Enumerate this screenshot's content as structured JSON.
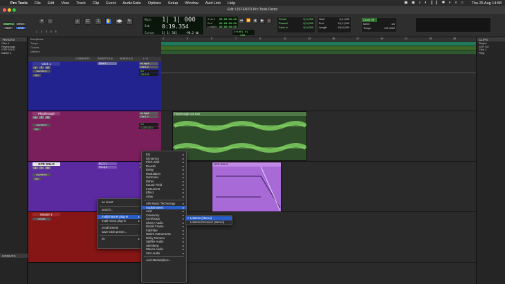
{
  "menubar": {
    "apple": "",
    "app": "Pro Tools",
    "items": [
      "File",
      "Edit",
      "View",
      "Track",
      "Clip",
      "Event",
      "AudioSuite",
      "Options",
      "Setup",
      "Window",
      "Avid Link",
      "Help"
    ],
    "clock": "Thu 25 Aug  14:58"
  },
  "window": {
    "title": "Edit: LISTENTO Pro Tools Demo"
  },
  "toolbar": {
    "modes": [
      "SHUFFLE",
      "SPOT",
      "SLIP",
      "GRID"
    ],
    "counters": {
      "main_label": "Main",
      "main_value": "1| 1| 000",
      "sub_label": "Sub",
      "sub_value": "0:19.354",
      "cursor_label": "Cursor",
      "cursor_value": "5| 1| 541",
      "start_label": "Start",
      "start_value": "00:00:00:00",
      "end_label": "End",
      "end_value": "00:00:00:00",
      "length_label": "Length",
      "length_value": "00:00:00:00",
      "grid_label": "Grid",
      "grid_value": "0| 0| 240",
      "nudge_label": "Nudge",
      "nudge_value": "0| 0| 000",
      "db_value": "-98.2 db"
    },
    "preroll": {
      "pre": "Preroll",
      "post": "Postroll",
      "fade": "Fade-in",
      "pre_v": "0| 0| 000",
      "post_v": "0| 0| 000",
      "fade_v": "0| 0| 000"
    },
    "sel": {
      "start": "Start",
      "end": "End",
      "length": "Length",
      "start_v": "1| 1| 000",
      "end_v": "11| 1| 000",
      "length_v": "10| 0| 000"
    },
    "transport_meter": {
      "count": "Count Off",
      "meter": "Meter",
      "meter_v": "4/4",
      "tempo": "Tempo",
      "tempo_v": "124.0000"
    }
  },
  "panels": {
    "tracks": "TRACKS",
    "groups": "GROUPS",
    "clips": "CLIPS"
  },
  "track_list": [
    "Click 1",
    "Playthrough",
    "GTR SOLO",
    "Master 1"
  ],
  "clip_list": [
    "Playthr",
    "GTR SO",
    "Click 1",
    "Playt"
  ],
  "rulers": [
    "Bars|Beats",
    "Tempo",
    "Chords",
    "Markers"
  ],
  "ruler_bars": [
    "1",
    "3",
    "5",
    "7",
    "9",
    "11",
    "13",
    "15",
    "17",
    "19",
    "21",
    "23",
    "25"
  ],
  "columns": [
    "COMMENTS",
    "INSERTS A-E",
    "SENDS A-E",
    "I / O"
  ],
  "tracks": [
    {
      "name": "Click 1",
      "insert": "Click II",
      "io_in": "no input",
      "io_out": "Out 1-2",
      "vol": "0.0",
      "pan": "100 100",
      "btn1": "waveform",
      "btn2": "dyn",
      "color": "#23238f"
    },
    {
      "name": "Playthrough",
      "insert": "",
      "io_in": "no input",
      "io_out": "Out 1-2",
      "vol": "0.0",
      "pan": "< 100  100 >",
      "btn1": "waveform",
      "btn2": "dyn",
      "color": "#7b1f5c"
    },
    {
      "name": "GTR SOLO",
      "insert": "EQ 3-1",
      "insert2": "Pro-Q 3",
      "io_in": "no input",
      "io_out": "Out 1-2",
      "btn1": "waveform",
      "btn2": "dyn",
      "color": "#5c2aa0"
    },
    {
      "name": "Master 1",
      "insert": "",
      "io_out": "Out 1-2",
      "btn1": "volume",
      "color": "#861616"
    }
  ],
  "clips": [
    {
      "title": "Playthrough vox solo",
      "color": "#2f4c2a"
    },
    {
      "title": "GTR SOLO",
      "color": "#a76ad6"
    }
  ],
  "menu_insert": {
    "items": [
      "no insert",
      "search...",
      "multichannel plug-in",
      "multi-mono plug-in",
      "recall inserts",
      "save track preset...",
      "i/o"
    ],
    "highlighted": "multichannel plug-in"
  },
  "menu_categories": {
    "items": [
      "EQ",
      "Dynamics",
      "Pitch Shift",
      "Reverb",
      "Delay",
      "Modulation",
      "Harmonic",
      "Dither",
      "Sound Field",
      "Instrument",
      "Effect",
      "Other",
      "AIR Music Technology",
      "Audiomovers",
      "Avid",
      "Celemony",
      "Cerebrops",
      "Cherry Audio",
      "Divide Frame",
      "FabFilter",
      "Native Instruments",
      "Nicky Romero",
      "Spitfire Audio",
      "Steinberg",
      "Waves Audio",
      "XLN Audio",
      "Avid Marketplace..."
    ],
    "highlighted": "Audiomovers"
  },
  "menu_plugins": {
    "items": [
      "Listento (stereo)",
      "Listento Receiver (stereo)"
    ],
    "highlighted": "Listento (stereo)"
  },
  "colors": {
    "highlight": "#2a5fc9",
    "green_lcd": "#7dff7d"
  }
}
